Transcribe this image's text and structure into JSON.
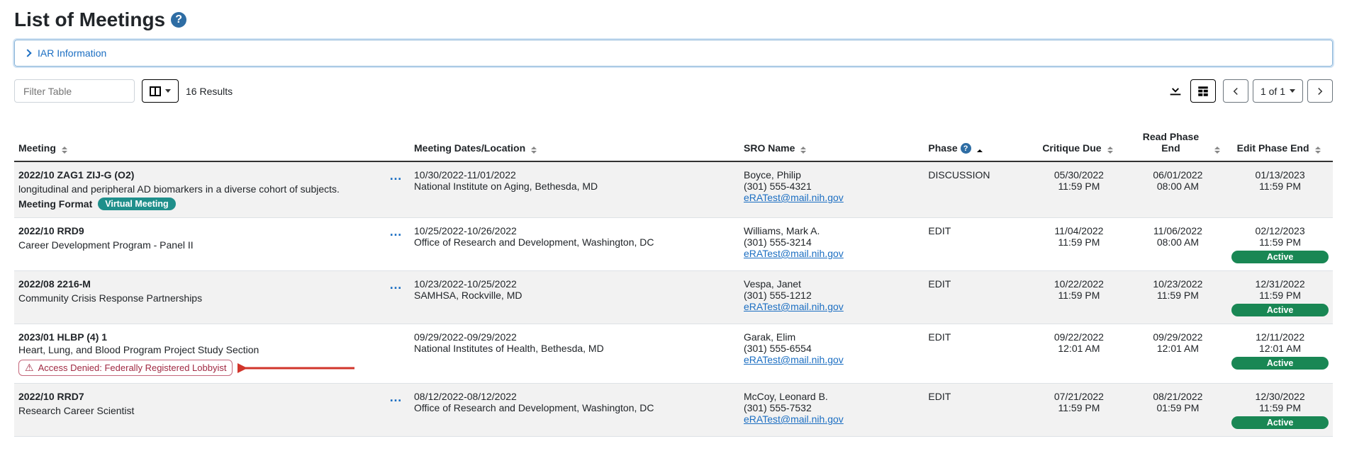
{
  "page": {
    "title": "List of Meetings",
    "info_panel_label": "IAR Information",
    "filter_placeholder": "Filter Table",
    "results_count": "16 Results",
    "pager_label": "1 of 1"
  },
  "columns": {
    "meeting": "Meeting",
    "dates": "Meeting Dates/Location",
    "sro": "SRO Name",
    "phase": "Phase",
    "critique": "Critique Due",
    "readphase": "Read Phase End",
    "editphase": "Edit Phase End"
  },
  "labels": {
    "meeting_format": "Meeting Format",
    "virtual_badge": "Virtual Meeting",
    "active_badge": "Active",
    "access_denied": "Access Denied: Federally Registered Lobbyist"
  },
  "rows": [
    {
      "alt": true,
      "code": "2022/10 ZAG1 ZIJ-G (O2)",
      "desc": "longitudinal and peripheral AD biomarkers in a diverse cohort of subjects.",
      "show_format": true,
      "virtual": true,
      "has_actions": true,
      "dates": "10/30/2022-11/01/2022",
      "loc": "National Institute on Aging, Bethesda, MD",
      "sro_name": "Boyce, Philip",
      "sro_phone": "(301) 555-4321",
      "sro_email": "eRATest@mail.nih.gov",
      "phase": "DISCUSSION",
      "crit_date": "05/30/2022",
      "crit_time": "11:59 PM",
      "read_date": "06/01/2022",
      "read_time": "08:00 AM",
      "edit_date": "01/13/2023",
      "edit_time": "11:59 PM",
      "edit_active": false,
      "access_denied": false
    },
    {
      "alt": false,
      "code": "2022/10 RRD9",
      "desc": "Career Development Program - Panel II",
      "show_format": false,
      "virtual": false,
      "has_actions": true,
      "dates": "10/25/2022-10/26/2022",
      "loc": "Office of Research and Development, Washington, DC",
      "sro_name": "Williams, Mark A.",
      "sro_phone": "(301) 555-3214",
      "sro_email": "eRATest@mail.nih.gov",
      "phase": "EDIT",
      "crit_date": "11/04/2022",
      "crit_time": "11:59 PM",
      "read_date": "11/06/2022",
      "read_time": "08:00 AM",
      "edit_date": "02/12/2023",
      "edit_time": "11:59 PM",
      "edit_active": true,
      "access_denied": false
    },
    {
      "alt": true,
      "code": "2022/08 2216-M",
      "desc": "Community Crisis Response Partnerships",
      "show_format": false,
      "virtual": false,
      "has_actions": true,
      "dates": "10/23/2022-10/25/2022",
      "loc": "SAMHSA, Rockville, MD",
      "sro_name": "Vespa, Janet",
      "sro_phone": "(301) 555-1212",
      "sro_email": "eRATest@mail.nih.gov",
      "phase": "EDIT",
      "crit_date": "10/22/2022",
      "crit_time": "11:59 PM",
      "read_date": "10/23/2022",
      "read_time": "11:59 PM",
      "edit_date": "12/31/2022",
      "edit_time": "11:59 PM",
      "edit_active": true,
      "access_denied": false
    },
    {
      "alt": false,
      "code": "2023/01 HLBP (4) 1",
      "desc": "Heart, Lung, and Blood Program Project Study Section",
      "show_format": false,
      "virtual": false,
      "has_actions": false,
      "dates": "09/29/2022-09/29/2022",
      "loc": "National Institutes of Health, Bethesda, MD",
      "sro_name": "Garak, Elim",
      "sro_phone": "(301) 555-6554",
      "sro_email": "eRATest@mail.nih.gov",
      "phase": "EDIT",
      "crit_date": "09/22/2022",
      "crit_time": "12:01 AM",
      "read_date": "09/29/2022",
      "read_time": "12:01 AM",
      "edit_date": "12/11/2022",
      "edit_time": "12:01 AM",
      "edit_active": true,
      "access_denied": true
    },
    {
      "alt": true,
      "code": "2022/10 RRD7",
      "desc": "Research Career Scientist",
      "show_format": false,
      "virtual": false,
      "has_actions": true,
      "dates": "08/12/2022-08/12/2022",
      "loc": "Office of Research and Development, Washington, DC",
      "sro_name": "McCoy, Leonard B.",
      "sro_phone": "(301) 555-7532",
      "sro_email": "eRATest@mail.nih.gov",
      "phase": "EDIT",
      "crit_date": "07/21/2022",
      "crit_time": "11:59 PM",
      "read_date": "08/21/2022",
      "read_time": "01:59 PM",
      "edit_date": "12/30/2022",
      "edit_time": "11:59 PM",
      "edit_active": true,
      "access_denied": false
    }
  ]
}
